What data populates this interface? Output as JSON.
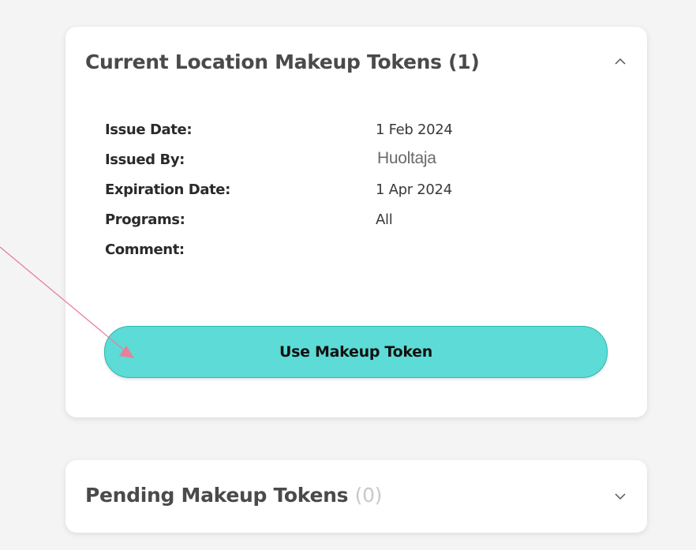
{
  "current_tokens": {
    "title": "Current Location Makeup Tokens (1)",
    "expanded": true,
    "details": [
      {
        "label": "Issue Date:",
        "value": "1 Feb 2024"
      },
      {
        "label": "Issued By:",
        "value": "Huoltaja"
      },
      {
        "label": "Expiration Date:",
        "value": "1 Apr 2024"
      },
      {
        "label": "Programs:",
        "value": "All"
      },
      {
        "label": "Comment:",
        "value": ""
      }
    ],
    "use_button_label": "Use Makeup Token",
    "button_color": "#5ddbd6"
  },
  "pending_tokens": {
    "title": "Pending Makeup Tokens",
    "count": "(0)",
    "expanded": false
  },
  "annotation": {
    "color": "#e8809a",
    "icon": "arrow-pointer-icon"
  }
}
